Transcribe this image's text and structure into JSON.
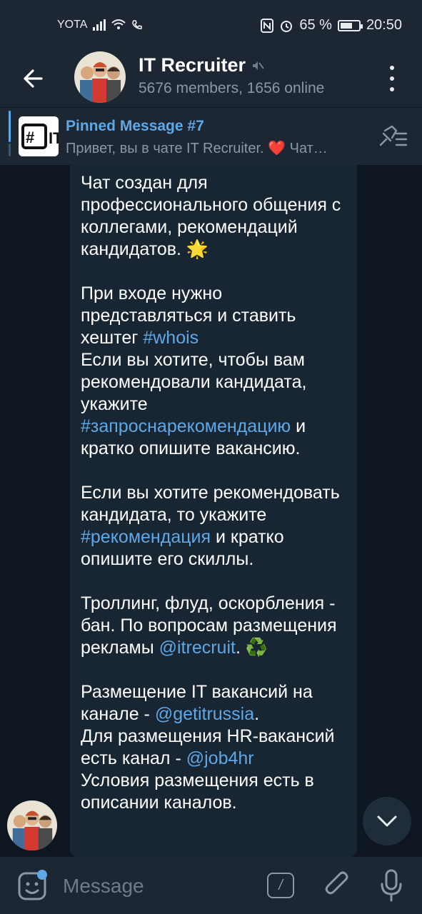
{
  "status_bar": {
    "carrier": "YOTA",
    "battery": "65 %",
    "battery_level": 0.65,
    "time": "20:50"
  },
  "header": {
    "title": "IT Recruiter",
    "subtitle": "5676 members, 1656 online"
  },
  "pinned": {
    "title": "Pinned Message #7",
    "preview": "Привет, вы в чате IT Recruiter. ❤️  Чат…",
    "thumb_text": "# IT"
  },
  "message": {
    "p1": "Чат создан для профессионального общения с коллегами, рекомендаций кандидатов. 🌟",
    "p2_a": "При входе нужно представляться и ставить хештег ",
    "p2_link": "#whois",
    "p3_a": "Если вы хотите, чтобы вам рекомендовали кандидата, укажите ",
    "p3_link": "#запроснарекомендацию",
    "p3_b": " и кратко опишите вакансию.",
    "p4_a": "Если вы хотите рекомендовать кандидата, то укажите ",
    "p4_link": "#рекомендация",
    "p4_b": " и кратко опишите его скиллы.",
    "p5_a": "Троллинг, флуд, оскорбления - бан. По вопросам размещения рекламы ",
    "p5_link": "@itrecruit",
    "p5_b": ". ♻️",
    "p6_a": "Размещение IT вакансий на канале - ",
    "p6_link": "@getitrussia",
    "p6_b": ".",
    "p7_a": "Для размещения HR-вакансий есть канал - ",
    "p7_link": "@job4hr",
    "p8": "Условия размещения есть в описании каналов."
  },
  "input": {
    "placeholder": "Message",
    "command_label": "/"
  },
  "colors": {
    "accent": "#5fa8e6",
    "background": "#0e1621",
    "bubble": "#182533",
    "bar": "#1c2733"
  }
}
